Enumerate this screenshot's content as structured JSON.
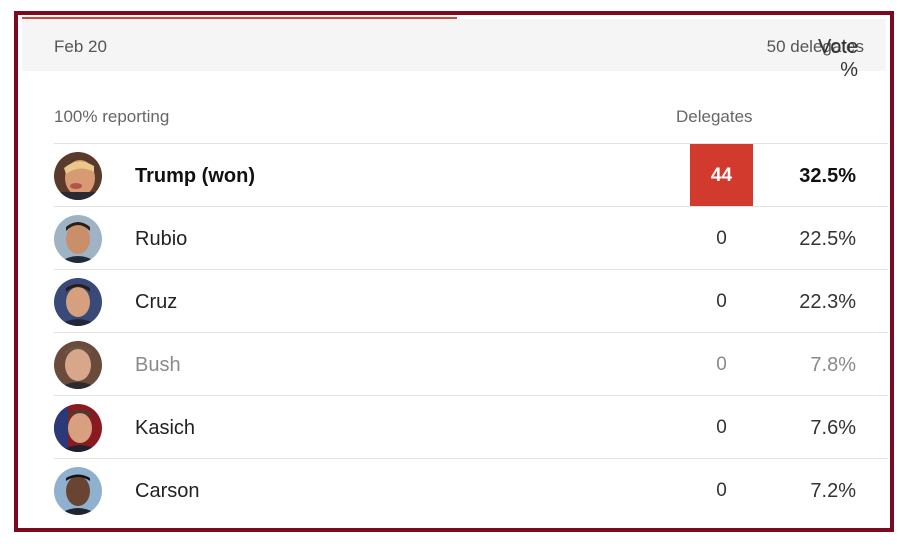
{
  "header": {
    "date": "Feb 20",
    "delegates_total": "50 delegates"
  },
  "columns": {
    "reporting": "100% reporting",
    "delegates": "Delegates",
    "vote": "Vote %"
  },
  "candidates": [
    {
      "name": "Trump (won)",
      "delegates": "44",
      "vote": "32.5%",
      "avatar_icon": "trump-portrait-icon"
    },
    {
      "name": "Rubio",
      "delegates": "0",
      "vote": "22.5%",
      "avatar_icon": "rubio-portrait-icon"
    },
    {
      "name": "Cruz",
      "delegates": "0",
      "vote": "22.3%",
      "avatar_icon": "cruz-portrait-icon"
    },
    {
      "name": "Bush",
      "delegates": "0",
      "vote": "7.8%",
      "avatar_icon": "bush-portrait-icon"
    },
    {
      "name": "Kasich",
      "delegates": "0",
      "vote": "7.6%",
      "avatar_icon": "kasich-portrait-icon"
    },
    {
      "name": "Carson",
      "delegates": "0",
      "vote": "7.2%",
      "avatar_icon": "carson-portrait-icon"
    }
  ],
  "colors": {
    "frame": "#7b0a1f",
    "winner_highlight": "#d23a2e",
    "header_bg": "#f5f5f5"
  }
}
